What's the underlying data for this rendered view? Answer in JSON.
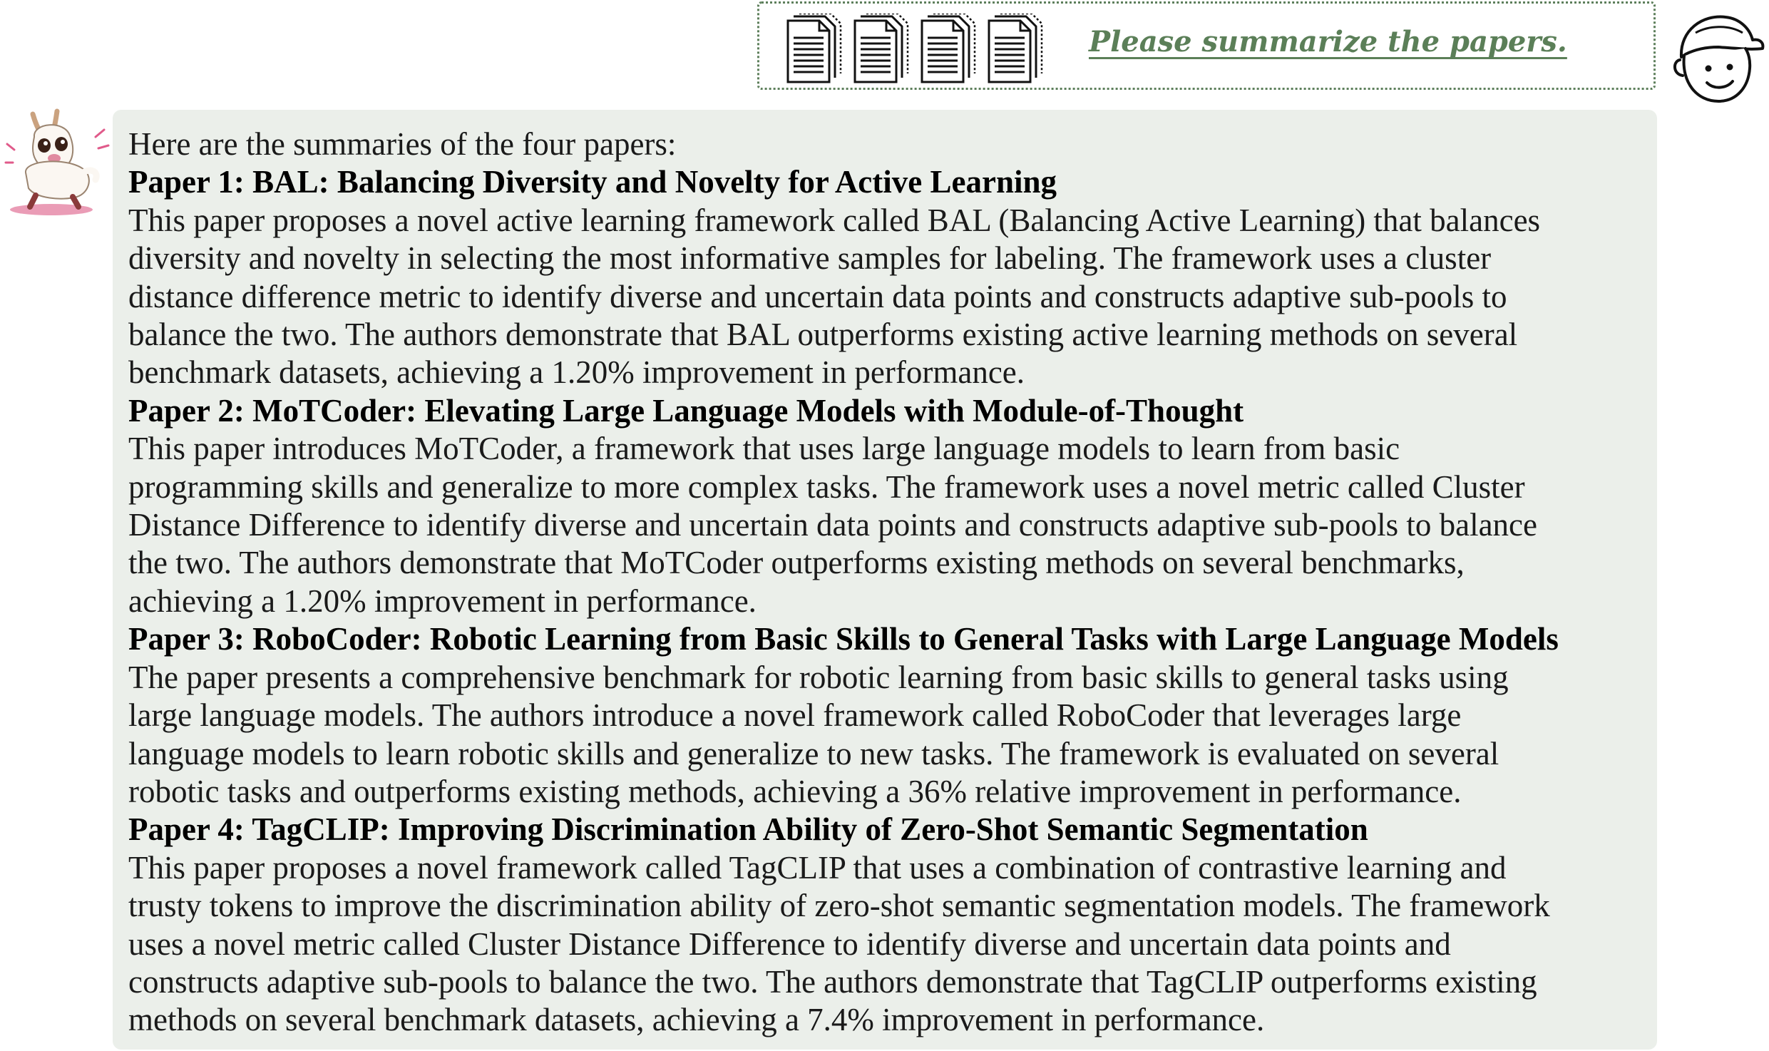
{
  "user_message": {
    "text": "Please summarize the papers.",
    "attachments": [
      "document-icon",
      "document-icon",
      "document-icon",
      "document-icon"
    ]
  },
  "assistant_message": {
    "intro": "Here are the summaries of the four papers:",
    "papers": [
      {
        "title": "Paper 1: BAL: Balancing Diversity and Novelty for Active Learning",
        "lines": [
          "This paper proposes a novel active learning framework called BAL (Balancing Active Learning) that balances",
          "diversity and novelty in selecting the most informative samples for labeling. The framework uses a cluster",
          "distance difference metric to identify diverse and uncertain data points and constructs adaptive sub-pools to",
          "balance the two. The authors demonstrate that BAL outperforms existing active learning methods on several",
          "benchmark datasets, achieving a 1.20% improvement in performance."
        ]
      },
      {
        "title": "Paper 2: MoTCoder: Elevating Large Language Models with Module-of-Thought",
        "lines": [
          "This paper introduces MoTCoder, a framework that uses large language models to learn from basic",
          "programming skills and generalize to more complex tasks. The framework uses a novel metric called Cluster",
          "Distance Difference to identify diverse and uncertain data points and constructs adaptive sub-pools to balance",
          "the two. The authors demonstrate that MoTCoder outperforms existing methods on several benchmarks,",
          "achieving a 1.20% improvement in performance."
        ]
      },
      {
        "title": "Paper 3: RoboCoder: Robotic Learning from Basic Skills to General Tasks with Large Language Models",
        "lines": [
          "The paper presents a comprehensive benchmark for robotic learning from basic skills to general tasks using",
          "large language models. The authors introduce a novel framework called RoboCoder that leverages large",
          "language models to learn robotic skills and generalize to new tasks. The framework is evaluated on several",
          "robotic tasks and outperforms existing methods, achieving a 36% relative improvement in performance."
        ]
      },
      {
        "title": "Paper 4: TagCLIP: Improving Discrimination Ability of Zero-Shot Semantic Segmentation",
        "lines": [
          "This paper proposes a novel framework called TagCLIP that uses a combination of contrastive learning and",
          "trusty tokens to improve the discrimination ability of zero-shot semantic segmentation models. The framework",
          "uses a novel metric called Cluster Distance Difference to identify diverse and uncertain data points and",
          "constructs adaptive sub-pools to balance the two. The authors demonstrate that TagCLIP outperforms existing",
          "methods on several benchmark datasets, achieving a 7.4% improvement in performance."
        ]
      }
    ]
  },
  "icons": {
    "user_avatar": "user-avatar-icon",
    "assistant_avatar": "llama-avatar-icon"
  },
  "colors": {
    "prompt_text": "#5b7f58",
    "bubble_border": "#5d7f5b",
    "response_background": "#ebefea"
  }
}
